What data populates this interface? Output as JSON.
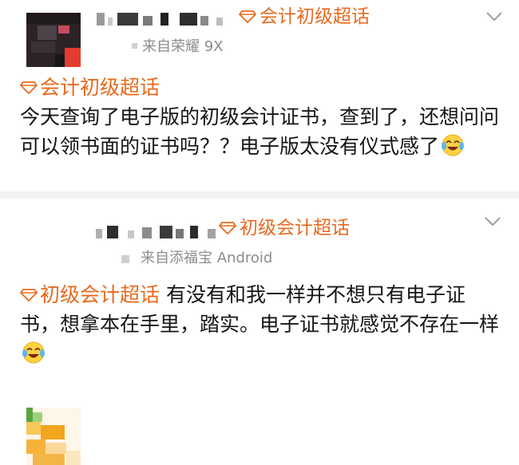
{
  "colors": {
    "accent": "#e86a1e",
    "tag_text": "#e86a1e",
    "meta": "#8c8c8c",
    "body_text": "#151515",
    "separator": "#f2f2f2"
  },
  "icons": {
    "topic": "diamond-gem-icon",
    "menu": "chevron-down-icon",
    "reaction": "laugh-cry-emoji-icon"
  },
  "posts": [
    {
      "header_tag": "会计初级超话",
      "source": "来自荣耀 9X",
      "content_tag": "会计初级超话",
      "text": "今天查询了电子版的初级会计证书，查到了，还想问问可以领书面的证书吗？？电子版太没有仪式感了"
    },
    {
      "header_tag": "初级会计超话",
      "source": "来自添福宝 Android",
      "content_tag": "初级会计超话",
      "text": "有没有和我一样并不想只有电子证书，想拿本在手里，踏实。电子证书就感觉不存在一样"
    }
  ]
}
